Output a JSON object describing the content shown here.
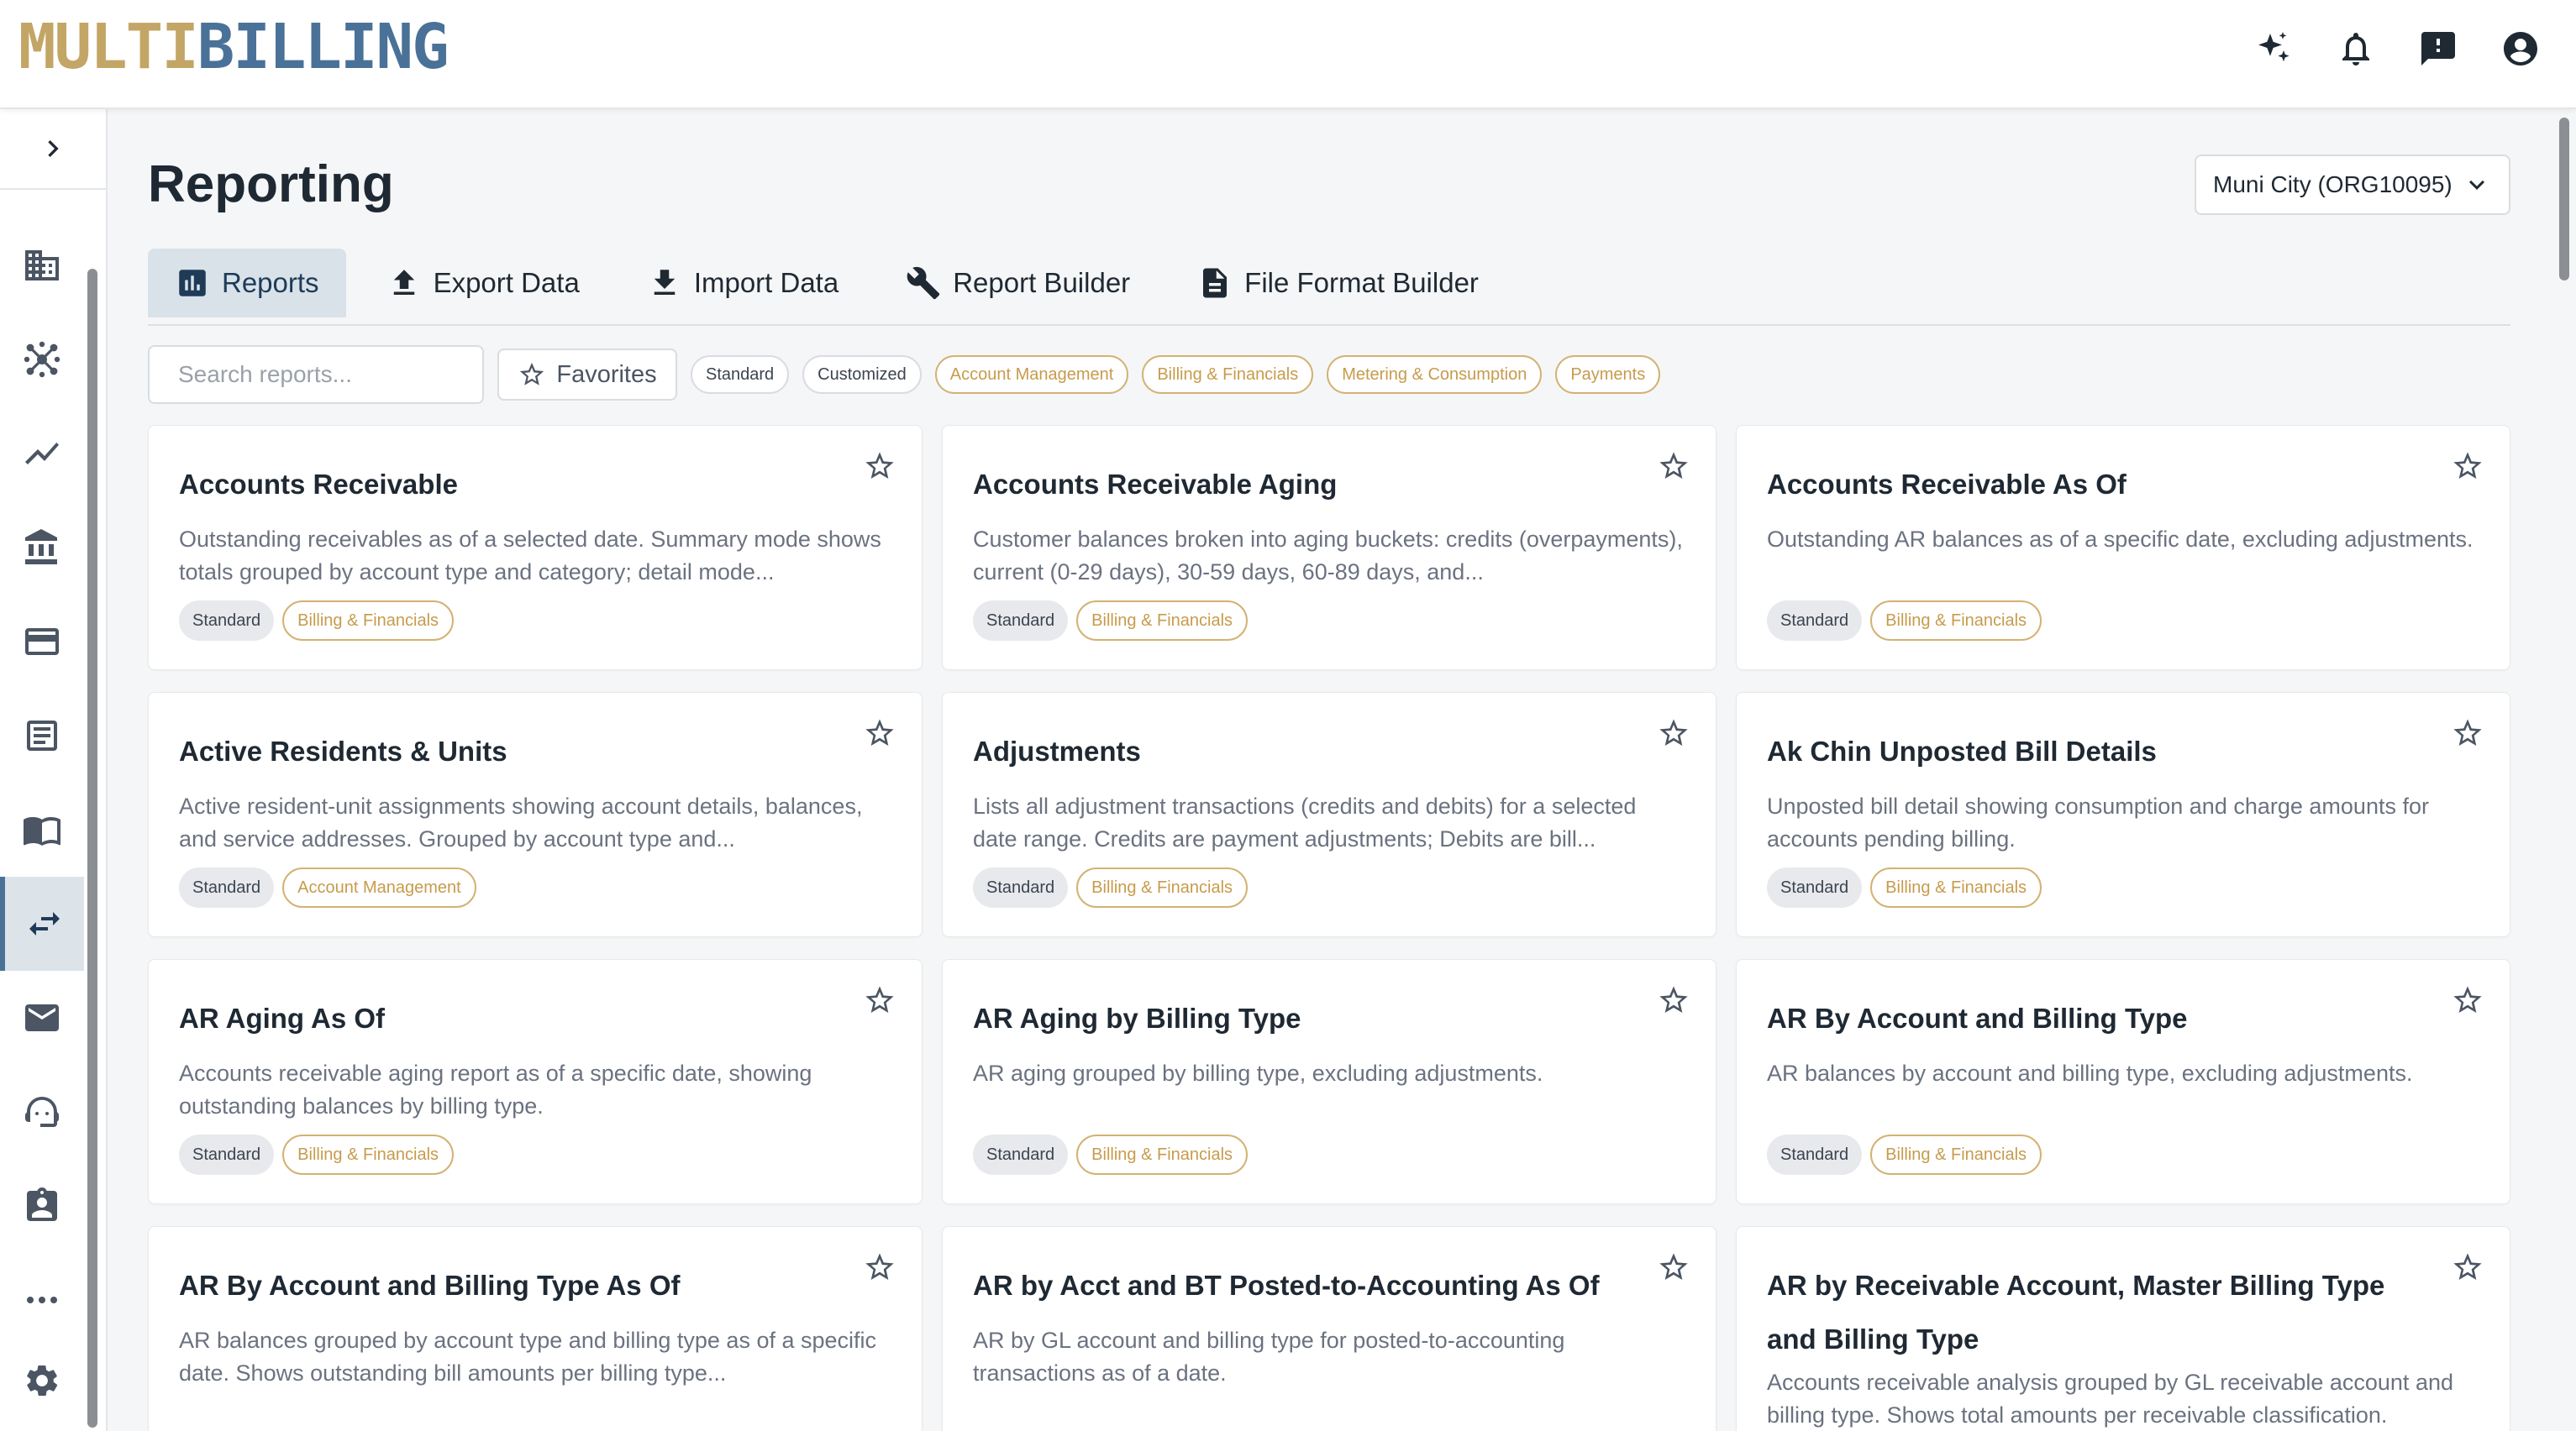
{
  "header": {
    "logo_part1": "MULTI",
    "logo_part2": "BILLING",
    "icons": [
      "sparkle-icon",
      "bell-icon",
      "feedback-icon",
      "account-circle-icon"
    ]
  },
  "sidebar": {
    "items": [
      {
        "icon": "building-icon"
      },
      {
        "icon": "network-hub-icon"
      },
      {
        "icon": "trend-line-icon"
      },
      {
        "icon": "bank-icon"
      },
      {
        "icon": "credit-card-icon"
      },
      {
        "icon": "list-document-icon"
      },
      {
        "icon": "book-icon"
      },
      {
        "icon": "swap-arrows-icon",
        "active": true
      },
      {
        "icon": "mail-icon"
      },
      {
        "icon": "support-agent-icon"
      },
      {
        "icon": "assignment-badge-icon"
      },
      {
        "icon": "more-horizontal-icon"
      }
    ],
    "settings_icon": "gear-icon"
  },
  "page": {
    "title": "Reporting",
    "org_select": "Muni City (ORG10095)"
  },
  "tabs": [
    {
      "label": "Reports",
      "icon": "bar-chart-icon",
      "active": true
    },
    {
      "label": "Export Data",
      "icon": "upload-icon"
    },
    {
      "label": "Import Data",
      "icon": "download-icon"
    },
    {
      "label": "Report Builder",
      "icon": "wrench-icon"
    },
    {
      "label": "File Format Builder",
      "icon": "file-icon"
    }
  ],
  "filters": {
    "search_placeholder": "Search reports...",
    "favorites_label": "Favorites",
    "chips": [
      {
        "label": "Standard",
        "style": "neutral"
      },
      {
        "label": "Customized",
        "style": "neutral"
      },
      {
        "label": "Account Management",
        "style": "accent"
      },
      {
        "label": "Billing & Financials",
        "style": "accent"
      },
      {
        "label": "Metering & Consumption",
        "style": "accent"
      },
      {
        "label": "Payments",
        "style": "accent"
      }
    ]
  },
  "cards": [
    {
      "title": "Accounts Receivable",
      "desc": "Outstanding receivables as of a selected date. Summary mode shows totals grouped by account type and category; detail mode...",
      "tags": [
        "Standard",
        "Billing & Financials"
      ]
    },
    {
      "title": "Accounts Receivable Aging",
      "desc": "Customer balances broken into aging buckets: credits (overpayments), current (0-29 days), 30-59 days, 60-89 days, and...",
      "tags": [
        "Standard",
        "Billing & Financials"
      ]
    },
    {
      "title": "Accounts Receivable As Of",
      "desc": "Outstanding AR balances as of a specific date, excluding adjustments.",
      "tags": [
        "Standard",
        "Billing & Financials"
      ]
    },
    {
      "title": "Active Residents & Units",
      "desc": "Active resident-unit assignments showing account details, balances, and service addresses. Grouped by account type and...",
      "tags": [
        "Standard",
        "Account Management"
      ]
    },
    {
      "title": "Adjustments",
      "desc": "Lists all adjustment transactions (credits and debits) for a selected date range. Credits are payment adjustments; Debits are bill...",
      "tags": [
        "Standard",
        "Billing & Financials"
      ]
    },
    {
      "title": "Ak Chin Unposted Bill Details",
      "desc": "Unposted bill detail showing consumption and charge amounts for accounts pending billing.",
      "tags": [
        "Standard",
        "Billing & Financials"
      ]
    },
    {
      "title": "AR Aging As Of",
      "desc": "Accounts receivable aging report as of a specific date, showing outstanding balances by billing type.",
      "tags": [
        "Standard",
        "Billing & Financials"
      ]
    },
    {
      "title": "AR Aging by Billing Type",
      "desc": "AR aging grouped by billing type, excluding adjustments.",
      "tags": [
        "Standard",
        "Billing & Financials"
      ]
    },
    {
      "title": "AR By Account and Billing Type",
      "desc": "AR balances by account and billing type, excluding adjustments.",
      "tags": [
        "Standard",
        "Billing & Financials"
      ]
    },
    {
      "title": "AR By Account and Billing Type As Of",
      "desc": "AR balances grouped by account type and billing type as of a specific date. Shows outstanding bill amounts per billing type...",
      "tags": []
    },
    {
      "title": "AR by Acct and BT Posted-to-Accounting As Of",
      "desc": "AR by GL account and billing type for posted-to-accounting transactions as of a date.",
      "tags": []
    },
    {
      "title": "AR by Receivable Account, Master Billing Type and Billing Type",
      "desc": "Accounts receivable analysis grouped by GL receivable account and billing type. Shows total amounts per receivable classification.",
      "tags": [],
      "tall": true
    }
  ]
}
